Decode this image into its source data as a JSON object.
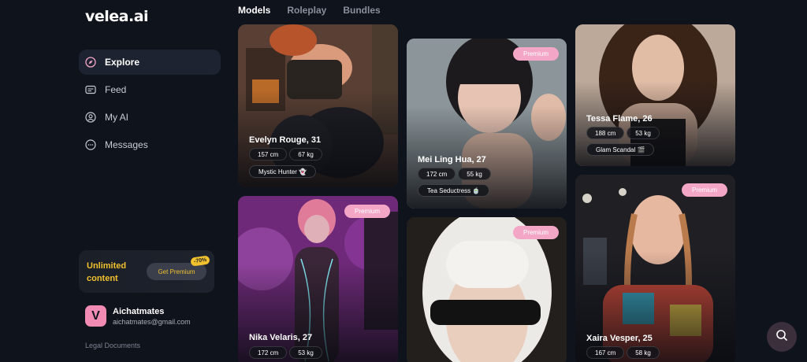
{
  "brand": {
    "logo": "velea.ai"
  },
  "tabs": [
    {
      "label": "Models",
      "active": true
    },
    {
      "label": "Roleplay",
      "active": false
    },
    {
      "label": "Bundles",
      "active": false
    }
  ],
  "nav": [
    {
      "label": "Explore",
      "icon": "compass-icon",
      "active": true
    },
    {
      "label": "Feed",
      "icon": "feed-icon",
      "active": false
    },
    {
      "label": "My AI",
      "icon": "user-circle-icon",
      "active": false
    },
    {
      "label": "Messages",
      "icon": "chat-bubble-icon",
      "active": false
    }
  ],
  "promo": {
    "text": "Unlimited content",
    "button": "Get Premium",
    "discount": "-70%"
  },
  "user": {
    "avatar_letter": "V",
    "name": "Aichatmates",
    "email": "aichatmates@gmail.com"
  },
  "legal": "Legal Documents",
  "cards": [
    {
      "name": "Evelyn Rouge, 31",
      "height": "157 cm",
      "weight": "67 kg",
      "tag": "Mystic Hunter 👻",
      "premium": ""
    },
    {
      "name": "Mei Ling Hua, 27",
      "height": "172 cm",
      "weight": "55 kg",
      "tag": "Tea Seductress 🍵",
      "premium": "Premium"
    },
    {
      "name": "Tessa Flame, 26",
      "height": "188 cm",
      "weight": "53 kg",
      "tag": "Glam Scandal 🎬",
      "premium": ""
    },
    {
      "name": "Nika Velaris, 27",
      "height": "172 cm",
      "weight": "53 kg",
      "tag": "",
      "premium": "Premium"
    },
    {
      "name": "",
      "height": "",
      "weight": "",
      "tag": "",
      "premium": "Premium"
    },
    {
      "name": "Xaira Vesper, 25",
      "height": "167 cm",
      "weight": "58 kg",
      "tag": "",
      "premium": "Premium"
    }
  ],
  "colors": {
    "background": "#0f131c",
    "accent_pink": "#f4a6c7",
    "promo_yellow": "#f2c12e"
  }
}
